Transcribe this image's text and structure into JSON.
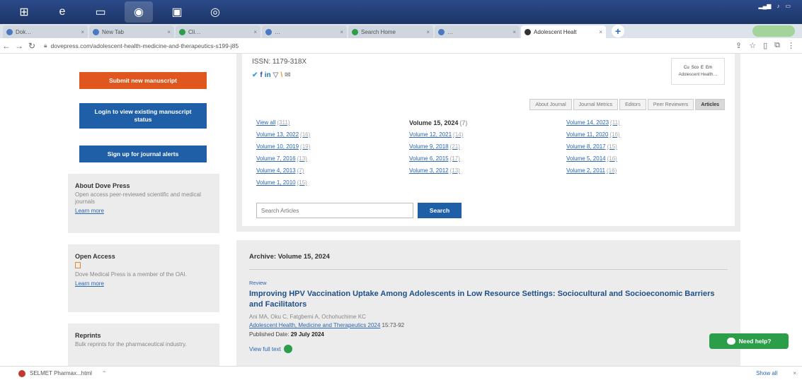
{
  "taskbar": {
    "apps": [
      {
        "name": "start-icon",
        "glyph": "⊞"
      },
      {
        "name": "edge-icon",
        "glyph": "e"
      },
      {
        "name": "file-explorer-icon",
        "glyph": "▭"
      },
      {
        "name": "chrome-icon",
        "glyph": "◉"
      },
      {
        "name": "media-icon",
        "glyph": "▣"
      },
      {
        "name": "camera-icon",
        "glyph": "◎"
      }
    ]
  },
  "tabs": [
    {
      "title": "Dok…",
      "active": false
    },
    {
      "title": "New Tab",
      "active": false
    },
    {
      "title": "Cli…",
      "active": false
    },
    {
      "title": "…",
      "active": false
    },
    {
      "title": "Search Home",
      "active": false
    },
    {
      "title": "…",
      "active": false
    },
    {
      "title": "Adolescent Healt",
      "active": true
    }
  ],
  "address": {
    "url": "dovepress.com/adolescent-health-medicine-and-therapeutics-s199-j85"
  },
  "sidebar": {
    "submit_label": "Submit new manuscript",
    "login_label": "Login to view existing manuscript status",
    "signup_label": "Sign up for journal alerts",
    "about": {
      "title": "About Dove Press",
      "text": "Open access peer-reviewed scientific and medical journals",
      "link": "Learn more"
    },
    "open_access": {
      "title": "Open Access",
      "text": "Dove Medical Press is a member of the OAI.",
      "link": "Learn more"
    },
    "reprints": {
      "title": "Reprints",
      "text": "Bulk reprints for the pharmaceutical industry."
    }
  },
  "journal": {
    "issn": "ISSN: 1179-318X",
    "cover_marks": [
      "Cu",
      "Sco",
      "E",
      "Em"
    ],
    "cover_caption": "Adolescent Health…",
    "tabs": [
      "About Journal",
      "Journal Metrics",
      "Editors",
      "Peer Reviewers",
      "Articles"
    ],
    "active_tab": "Articles",
    "volumes": [
      {
        "label": "View all",
        "count": "(311)",
        "current": false
      },
      {
        "label": "Volume 15, 2024",
        "count": "(7)",
        "current": true
      },
      {
        "label": "Volume 14, 2023",
        "count": "(11)",
        "current": false
      },
      {
        "label": "Volume 13, 2022",
        "count": "(16)",
        "current": false
      },
      {
        "label": "Volume 12, 2021",
        "count": "(14)",
        "current": false
      },
      {
        "label": "Volume 11, 2020",
        "count": "(16)",
        "current": false
      },
      {
        "label": "Volume 10, 2019",
        "count": "(19)",
        "current": false
      },
      {
        "label": "Volume 9, 2018",
        "count": "(21)",
        "current": false
      },
      {
        "label": "Volume 8, 2017",
        "count": "(15)",
        "current": false
      },
      {
        "label": "Volume 7, 2016",
        "count": "(13)",
        "current": false
      },
      {
        "label": "Volume 6, 2015",
        "count": "(17)",
        "current": false
      },
      {
        "label": "Volume 5, 2014",
        "count": "(16)",
        "current": false
      },
      {
        "label": "Volume 4, 2013",
        "count": "(7)",
        "current": false
      },
      {
        "label": "Volume 3, 2012",
        "count": "(13)",
        "current": false
      },
      {
        "label": "Volume 2, 2011",
        "count": "(16)",
        "current": false
      },
      {
        "label": "Volume 1, 2010",
        "count": "(15)",
        "current": false
      }
    ],
    "search_placeholder": "Search Articles",
    "search_button": "Search"
  },
  "archive": {
    "title": "Archive: Volume 15, 2024",
    "article": {
      "type": "Review",
      "title": "Improving HPV Vaccination Uptake Among Adolescents in Low Resource Settings: Sociocultural and Socioeconomic Barriers and Facilitators",
      "authors": "Ani MA, Oku C, Fatgbemi A, Ochohuchime KC",
      "journal_link": "Adolescent Health, Medicine and Therapeutics 2024",
      "pages": "15:73-92",
      "published_label": "Published Date:",
      "published_date": "29 July 2024",
      "views": "View full text"
    }
  },
  "help_button": "Need help?",
  "download": {
    "file": "SELMET Pharmax...html",
    "show_all": "Show all"
  }
}
